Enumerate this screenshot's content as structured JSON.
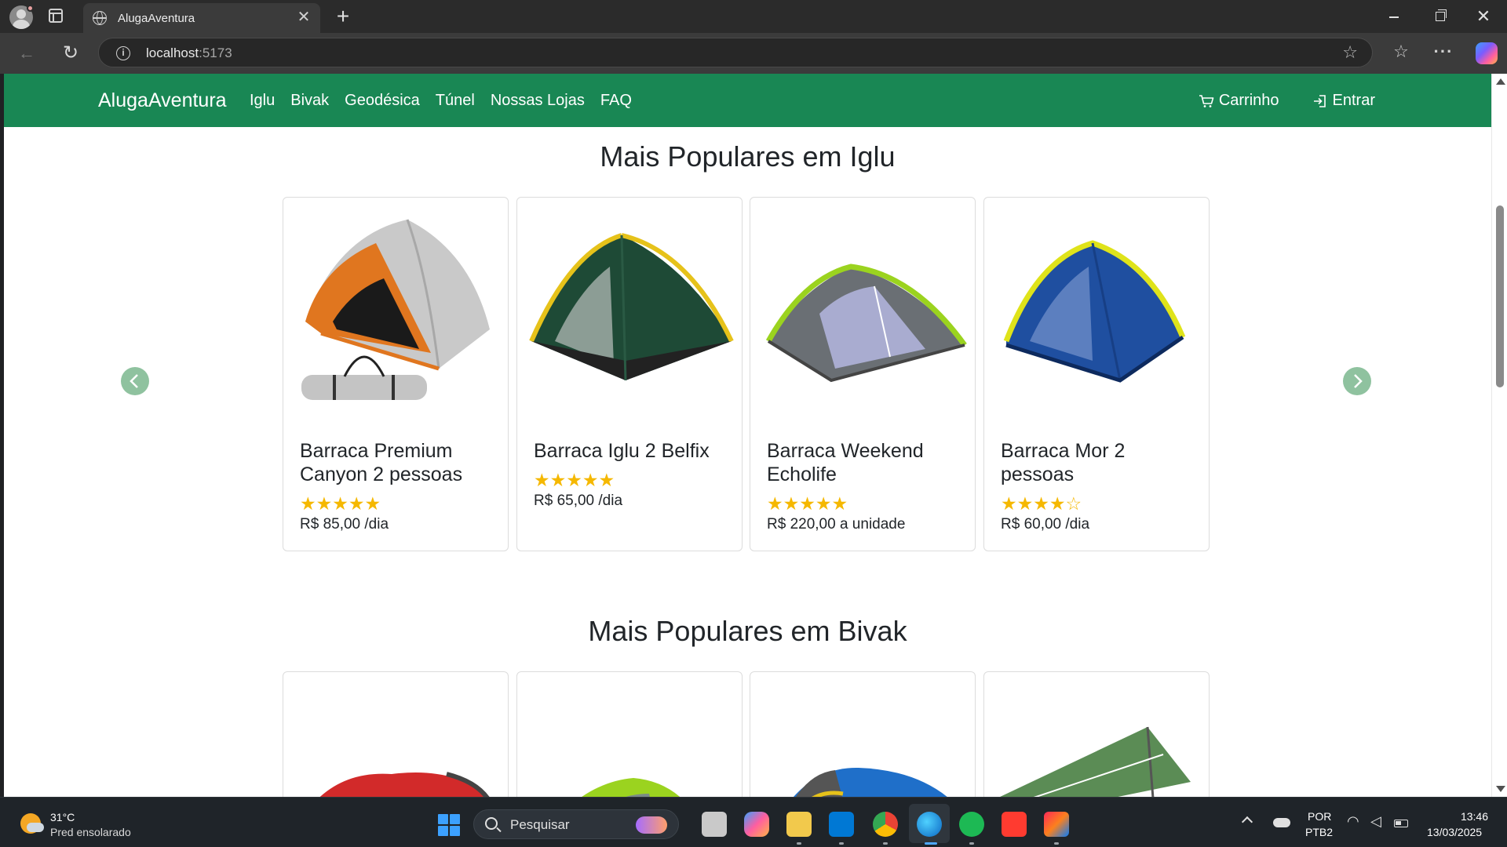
{
  "browser": {
    "tab_title": "AlugaAventura",
    "tab_close": "✕",
    "new_tab": "+",
    "url_host": "localhost",
    "url_port": ":5173"
  },
  "site": {
    "brand": "AlugaAventura",
    "nav_links": [
      "Iglu",
      "Bivak",
      "Geodésica",
      "Túnel",
      "Nossas Lojas",
      "FAQ"
    ],
    "cart_label": "Carrinho",
    "login_label": "Entrar",
    "accent_color": "#198754"
  },
  "sections": [
    {
      "title": "Mais Populares em Iglu",
      "products": [
        {
          "name": "Barraca Premium Canyon 2 pessoas",
          "rating": "★★★★★",
          "price": "R$ 85,00 /dia"
        },
        {
          "name": "Barraca Iglu 2 Belfix",
          "rating": "★★★★★",
          "price": "R$ 65,00 /dia"
        },
        {
          "name": "Barraca Weekend Echolife",
          "rating": "★★★★★",
          "price": "R$ 220,00 a unidade"
        },
        {
          "name": "Barraca Mor 2 pessoas",
          "rating_full": "★★★★",
          "rating_empty": "☆",
          "price": "R$ 60,00 /dia"
        }
      ]
    },
    {
      "title": "Mais Populares em Bivak"
    }
  ],
  "taskbar": {
    "temperature": "31°C",
    "weather": "Pred ensolarado",
    "search_placeholder": "Pesquisar",
    "lang1": "POR",
    "lang2": "PTB2",
    "time": "13:46",
    "date": "13/03/2025"
  }
}
